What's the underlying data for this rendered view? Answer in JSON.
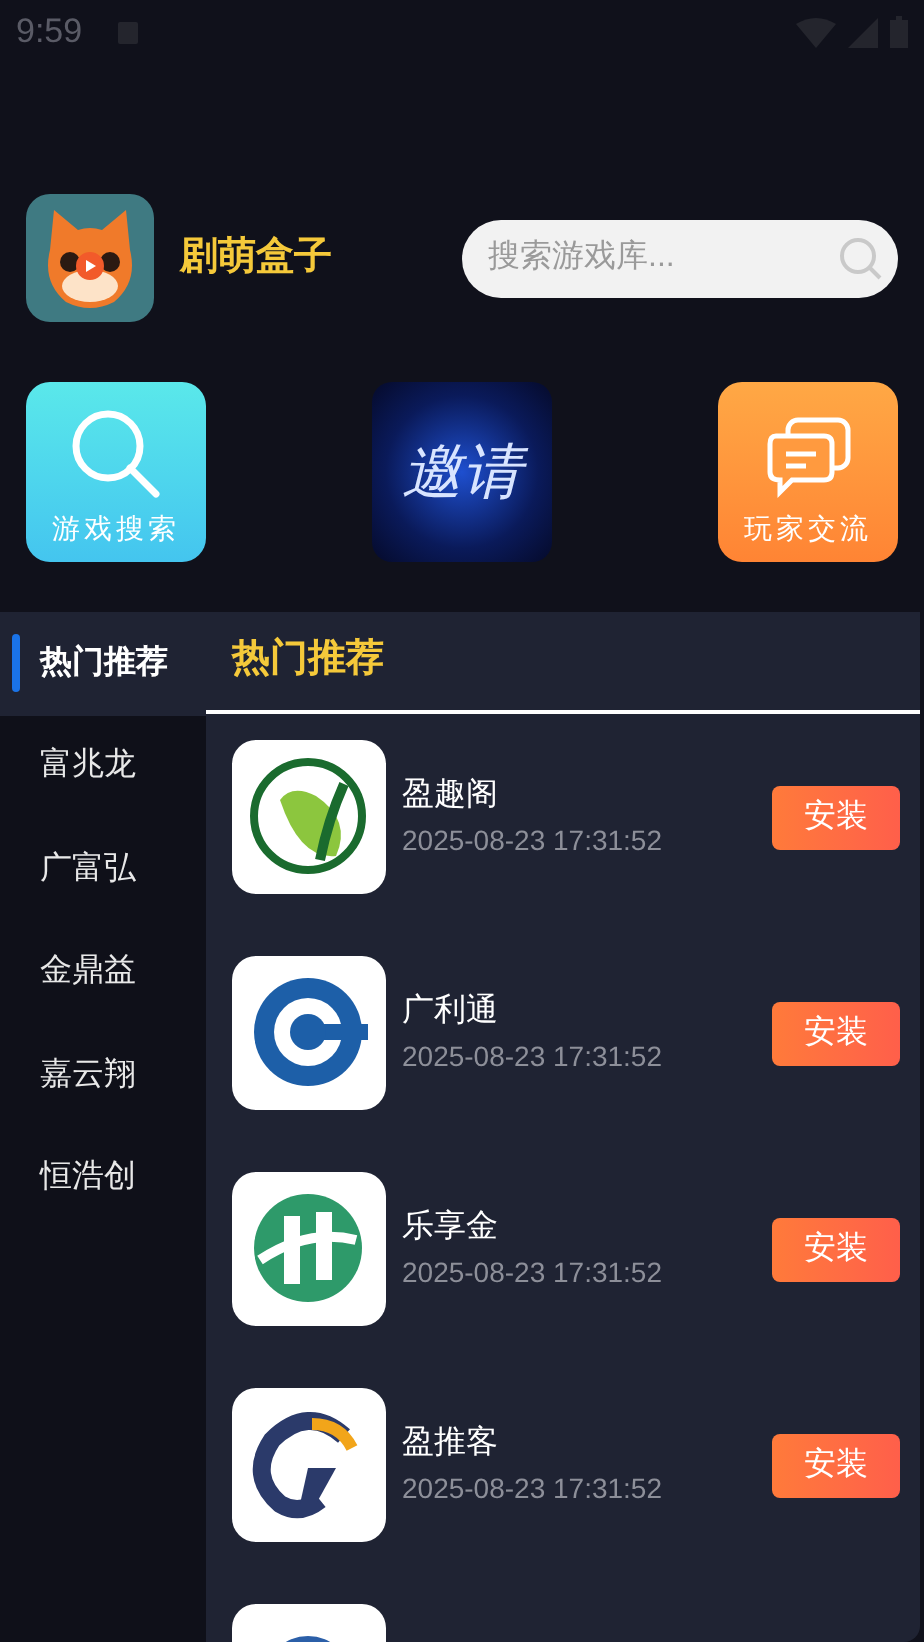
{
  "status_bar": {
    "time": "9:59"
  },
  "header": {
    "app_title": "剧萌盒子",
    "search": {
      "placeholder": "搜索游戏库..."
    }
  },
  "shortcuts": [
    {
      "kind": "search",
      "label": "游戏搜索"
    },
    {
      "kind": "invite",
      "label": "邀请"
    },
    {
      "kind": "chat",
      "label": "玩家交流"
    }
  ],
  "sidebar": {
    "items": [
      {
        "label": "热门推荐",
        "selected": true
      },
      {
        "label": "富兆龙",
        "selected": false
      },
      {
        "label": "广富弘",
        "selected": false
      },
      {
        "label": "金鼎益",
        "selected": false
      },
      {
        "label": "嘉云翔",
        "selected": false
      },
      {
        "label": "恒浩创",
        "selected": false
      }
    ]
  },
  "section_title": "热门推荐",
  "apps": [
    {
      "name": "盈趣阁",
      "date": "2025-08-23 17:31:52",
      "button": "安装"
    },
    {
      "name": "广利通",
      "date": "2025-08-23 17:31:52",
      "button": "安装"
    },
    {
      "name": "乐享金",
      "date": "2025-08-23 17:31:52",
      "button": "安装"
    },
    {
      "name": "盈推客",
      "date": "2025-08-23 17:31:52",
      "button": "安装"
    }
  ]
}
